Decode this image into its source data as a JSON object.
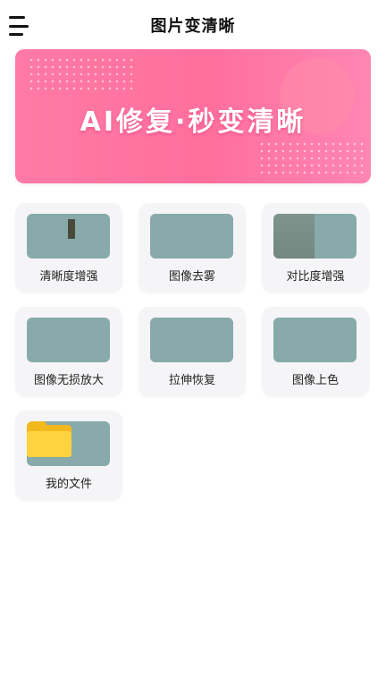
{
  "header": {
    "title": "图片变清晰",
    "menu_icon": "hamburger-menu-icon"
  },
  "banner": {
    "text": "AI修复·秒变清晰",
    "colors": {
      "start": "#ff7aa6",
      "end": "#ff86b2"
    }
  },
  "tools": [
    {
      "label": "清晰度增强",
      "icon": "clarity-enhance-image"
    },
    {
      "label": "图像去雾",
      "icon": "dehaze-image"
    },
    {
      "label": "对比度增强",
      "icon": "contrast-enhance-image"
    },
    {
      "label": "图像无损放大",
      "icon": "lossless-upscale-image"
    },
    {
      "label": "拉伸恢复",
      "icon": "stretch-restore-image"
    },
    {
      "label": "图像上色",
      "icon": "colorize-image"
    },
    {
      "label": "我的文件",
      "icon": "folder-icon"
    }
  ]
}
